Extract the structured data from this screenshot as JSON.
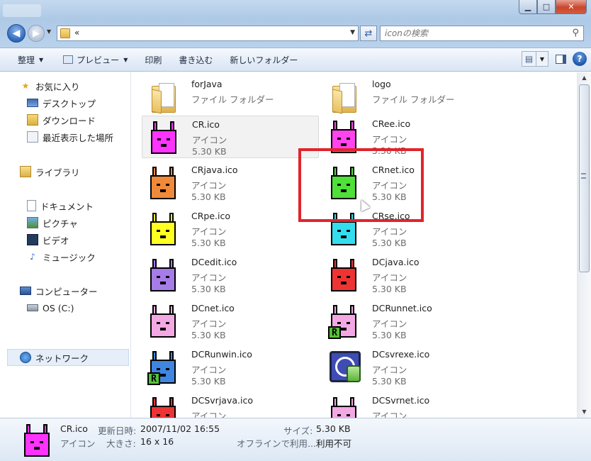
{
  "window": {
    "address": "«",
    "search_placeholder": "iconの検索",
    "min": "▁",
    "max": "□",
    "close": "✕"
  },
  "toolbar": {
    "organize": "整理",
    "preview": "プレビュー",
    "print": "印刷",
    "burn": "書き込む",
    "new_folder": "新しいフォルダー"
  },
  "nav": {
    "favorites": "お気に入り",
    "desktop": "デスクトップ",
    "downloads": "ダウンロード",
    "recent": "最近表示した場所",
    "libraries": "ライブラリ",
    "documents": "ドキュメント",
    "pictures": "ピクチャ",
    "videos": "ビデオ",
    "music": "ミュージック",
    "computer": "コンピューター",
    "os_drive": "OS (C:)",
    "network": "ネットワーク"
  },
  "files": [
    {
      "name": "forJava",
      "type": "ファイル フォルダー",
      "size": "",
      "kind": "folder"
    },
    {
      "name": "logo",
      "type": "ファイル フォルダー",
      "size": "",
      "kind": "folder"
    },
    {
      "name": "CR.ico",
      "type": "アイコン",
      "size": "5.30 KB",
      "kind": "rabbit",
      "color": "#ff33ff"
    },
    {
      "name": "CRee.ico",
      "type": "アイコン",
      "size": "5.30 KB",
      "kind": "rabbit",
      "color": "#ff44ee"
    },
    {
      "name": "CRjava.ico",
      "type": "アイコン",
      "size": "5.30 KB",
      "kind": "rabbit",
      "color": "#f08a3a"
    },
    {
      "name": "CRnet.ico",
      "type": "アイコン",
      "size": "5.30 KB",
      "kind": "rabbit",
      "color": "#4fe03a"
    },
    {
      "name": "CRpe.ico",
      "type": "アイコン",
      "size": "5.30 KB",
      "kind": "rabbit",
      "color": "#ffff22"
    },
    {
      "name": "CRse.ico",
      "type": "アイコン",
      "size": "5.30 KB",
      "kind": "rabbit",
      "color": "#33ddee"
    },
    {
      "name": "DCedit.ico",
      "type": "アイコン",
      "size": "5.30 KB",
      "kind": "rabbit",
      "color": "#a77be8"
    },
    {
      "name": "DCjava.ico",
      "type": "アイコン",
      "size": "5.30 KB",
      "kind": "rabbit",
      "color": "#ee3333"
    },
    {
      "name": "DCnet.ico",
      "type": "アイコン",
      "size": "5.30 KB",
      "kind": "rabbit",
      "color": "#f3a8e4"
    },
    {
      "name": "DCRunnet.ico",
      "type": "アイコン",
      "size": "5.30 KB",
      "kind": "rabbit-r",
      "color": "#f3a8e4"
    },
    {
      "name": "DCRunwin.ico",
      "type": "アイコン",
      "size": "5.30 KB",
      "kind": "rabbit-r",
      "color": "#3f86e0"
    },
    {
      "name": "DCsvrexe.ico",
      "type": "アイコン",
      "size": "5.30 KB",
      "kind": "server"
    },
    {
      "name": "DCSvrjava.ico",
      "type": "アイコン",
      "size": "",
      "kind": "rabbit",
      "color": "#ee3333"
    },
    {
      "name": "DCSvrnet.ico",
      "type": "アイコン",
      "size": "",
      "kind": "rabbit",
      "color": "#f3a8e4"
    }
  ],
  "details": {
    "name": "CR.ico",
    "type": "アイコン",
    "modified_label": "更新日時:",
    "modified": "2007/11/02 16:55",
    "dims_label": "大きさ:",
    "dims": "16 x 16",
    "size_label": "サイズ:",
    "size": "5.30 KB",
    "offline_label": "オフラインで利用...",
    "offline": "利用不可",
    "icon_color": "#ff33ff"
  },
  "colors": {
    "highlight": "#e0242b",
    "selection_bg": "#f2f2f2"
  }
}
